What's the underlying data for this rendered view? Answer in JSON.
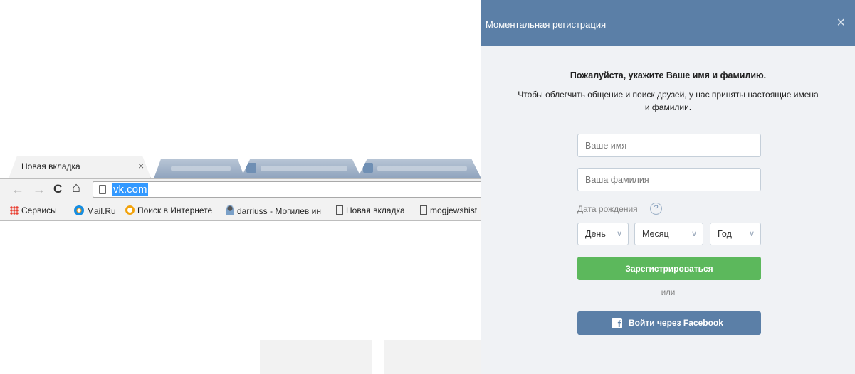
{
  "browser": {
    "active_tab": {
      "label": "Новая вкладка",
      "close_glyph": "×"
    },
    "nav": {
      "back": "←",
      "forward": "→",
      "reload": "C",
      "home": "⌂"
    },
    "address": {
      "url": "vk.com"
    },
    "bookmarks": [
      {
        "label": "Сервисы",
        "icon": "apps-grid-icon"
      },
      {
        "label": "Mail.Ru",
        "icon": "mailru-icon"
      },
      {
        "label": "Поиск в Интернете",
        "icon": "search-icon"
      },
      {
        "label": "darriuss - Могилев ин",
        "icon": "user-icon"
      },
      {
        "label": "Новая вкладка",
        "icon": "page-icon"
      },
      {
        "label": "mogjewshist",
        "icon": "page-icon"
      }
    ]
  },
  "modal": {
    "title": "Моментальная регистрация",
    "close_glyph": "×",
    "heading": "Пожалуйста, укажите Ваше имя и фамилию.",
    "subtext": "Чтобы облегчить общение и поиск друзей, у нас приняты настоящие имена и фамилии.",
    "first_name_placeholder": "Ваше имя",
    "last_name_placeholder": "Ваша фамилия",
    "dob_label": "Дата рождения",
    "dob_help": "?",
    "day": "День",
    "month": "Месяц",
    "year": "Год",
    "chevron": "∨",
    "register": "Зарегистрироваться",
    "or": "или",
    "facebook_glyph": "f",
    "facebook": "Войти через Facebook"
  },
  "colors": {
    "header": "#5b7fa7",
    "register_button": "#5cb85c",
    "facebook_button": "#5b7fa7",
    "modal_bg": "#f0f2f5",
    "url_highlight": "#3399ff"
  }
}
